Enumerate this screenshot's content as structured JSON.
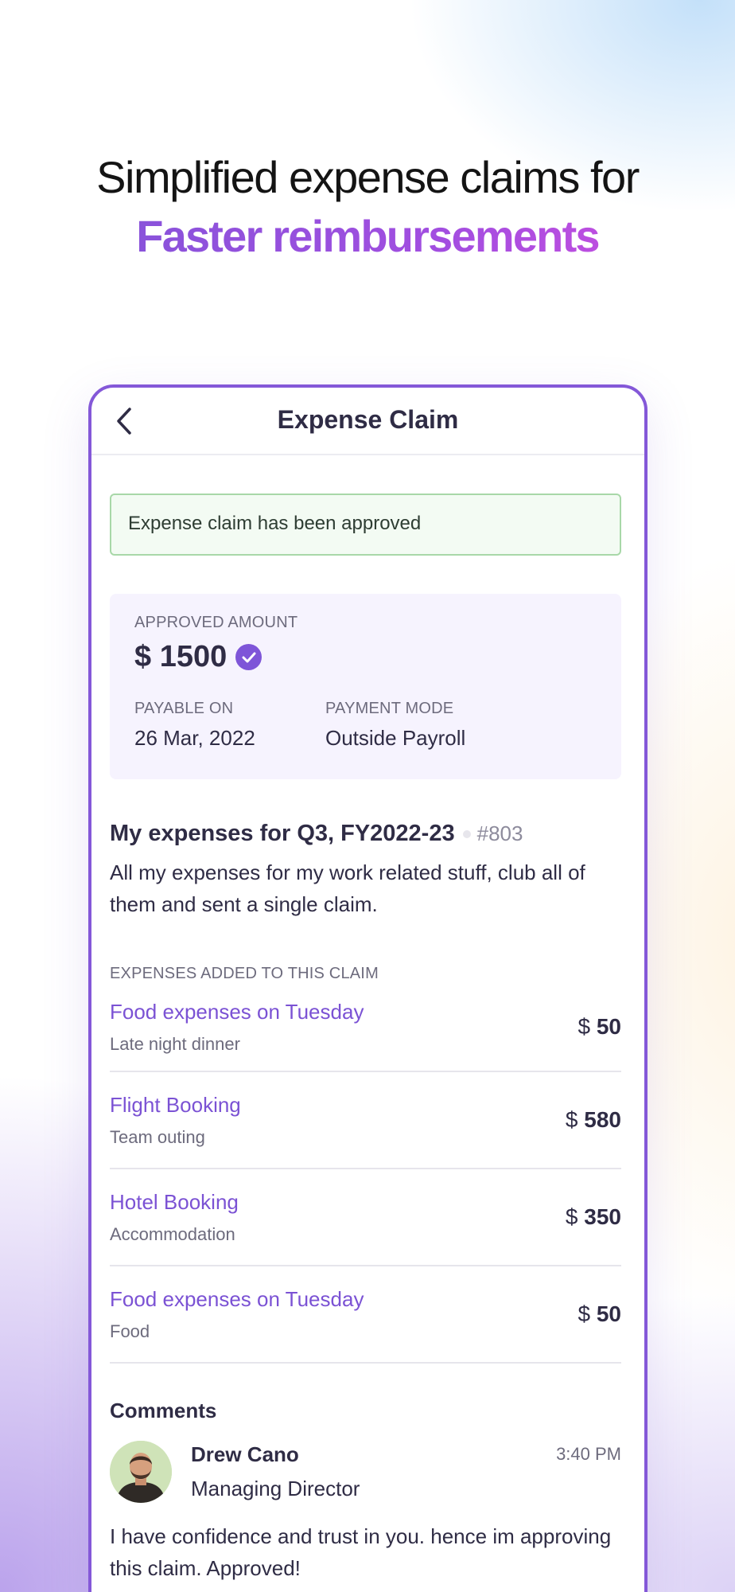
{
  "hero": {
    "line1": "Simplified expense claims for",
    "line2": "Faster reimbursements"
  },
  "appbar": {
    "title": "Expense Claim",
    "back_icon": "chevron-left-icon"
  },
  "alert": {
    "text": "Expense claim has been approved"
  },
  "approval": {
    "amount_label": "APPROVED AMOUNT",
    "amount": "$ 1500",
    "verified_icon": "check-circle-icon",
    "payable_label": "PAYABLE ON",
    "payable_value": "26 Mar, 2022",
    "mode_label": "PAYMENT MODE",
    "mode_value": "Outside Payroll"
  },
  "claim": {
    "title": "My expenses for Q3, FY2022-23",
    "id": "#803",
    "description": "All my expenses for my work related stuff, club all of them and sent a single claim."
  },
  "expenses": {
    "section_label": "EXPENSES ADDED TO THIS CLAIM",
    "items": [
      {
        "name": "Food expenses on Tuesday",
        "sub": "Late night dinner",
        "currency": "$",
        "amount": "50"
      },
      {
        "name": "Flight Booking",
        "sub": "Team outing",
        "currency": "$",
        "amount": "580"
      },
      {
        "name": "Hotel Booking",
        "sub": "Accommodation",
        "currency": "$",
        "amount": "350"
      },
      {
        "name": "Food expenses on Tuesday",
        "sub": "Food",
        "currency": "$",
        "amount": "50"
      }
    ]
  },
  "comments": {
    "title": "Comments",
    "items": [
      {
        "name": "Drew Cano",
        "role": "Managing Director",
        "time": "3:40 PM",
        "text": "I have confidence and trust in you. hence im approving this claim. Approved!"
      }
    ]
  },
  "colors": {
    "accent": "#7e55d8",
    "frame": "#8458d8",
    "success_border": "#a8d8a8",
    "success_bg": "#f3fbf3",
    "card_bg": "#f6f3fe"
  }
}
